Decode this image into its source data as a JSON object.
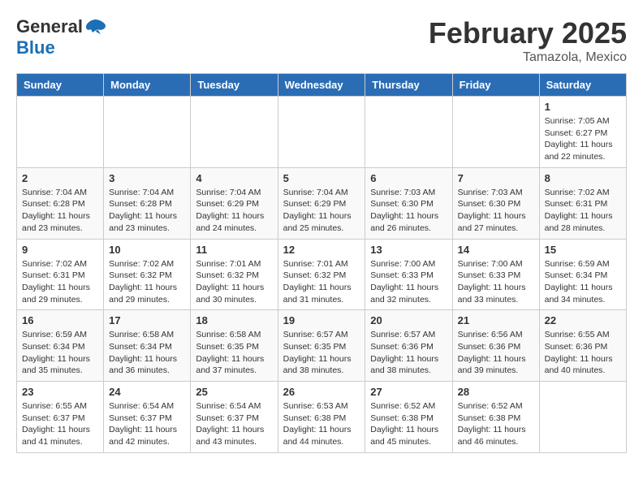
{
  "header": {
    "logo_general": "General",
    "logo_blue": "Blue",
    "month_title": "February 2025",
    "subtitle": "Tamazola, Mexico"
  },
  "days_of_week": [
    "Sunday",
    "Monday",
    "Tuesday",
    "Wednesday",
    "Thursday",
    "Friday",
    "Saturday"
  ],
  "weeks": [
    [
      {
        "day": "",
        "info": ""
      },
      {
        "day": "",
        "info": ""
      },
      {
        "day": "",
        "info": ""
      },
      {
        "day": "",
        "info": ""
      },
      {
        "day": "",
        "info": ""
      },
      {
        "day": "",
        "info": ""
      },
      {
        "day": "1",
        "info": "Sunrise: 7:05 AM\nSunset: 6:27 PM\nDaylight: 11 hours and 22 minutes."
      }
    ],
    [
      {
        "day": "2",
        "info": "Sunrise: 7:04 AM\nSunset: 6:28 PM\nDaylight: 11 hours and 23 minutes."
      },
      {
        "day": "3",
        "info": "Sunrise: 7:04 AM\nSunset: 6:28 PM\nDaylight: 11 hours and 23 minutes."
      },
      {
        "day": "4",
        "info": "Sunrise: 7:04 AM\nSunset: 6:29 PM\nDaylight: 11 hours and 24 minutes."
      },
      {
        "day": "5",
        "info": "Sunrise: 7:04 AM\nSunset: 6:29 PM\nDaylight: 11 hours and 25 minutes."
      },
      {
        "day": "6",
        "info": "Sunrise: 7:03 AM\nSunset: 6:30 PM\nDaylight: 11 hours and 26 minutes."
      },
      {
        "day": "7",
        "info": "Sunrise: 7:03 AM\nSunset: 6:30 PM\nDaylight: 11 hours and 27 minutes."
      },
      {
        "day": "8",
        "info": "Sunrise: 7:02 AM\nSunset: 6:31 PM\nDaylight: 11 hours and 28 minutes."
      }
    ],
    [
      {
        "day": "9",
        "info": "Sunrise: 7:02 AM\nSunset: 6:31 PM\nDaylight: 11 hours and 29 minutes."
      },
      {
        "day": "10",
        "info": "Sunrise: 7:02 AM\nSunset: 6:32 PM\nDaylight: 11 hours and 29 minutes."
      },
      {
        "day": "11",
        "info": "Sunrise: 7:01 AM\nSunset: 6:32 PM\nDaylight: 11 hours and 30 minutes."
      },
      {
        "day": "12",
        "info": "Sunrise: 7:01 AM\nSunset: 6:32 PM\nDaylight: 11 hours and 31 minutes."
      },
      {
        "day": "13",
        "info": "Sunrise: 7:00 AM\nSunset: 6:33 PM\nDaylight: 11 hours and 32 minutes."
      },
      {
        "day": "14",
        "info": "Sunrise: 7:00 AM\nSunset: 6:33 PM\nDaylight: 11 hours and 33 minutes."
      },
      {
        "day": "15",
        "info": "Sunrise: 6:59 AM\nSunset: 6:34 PM\nDaylight: 11 hours and 34 minutes."
      }
    ],
    [
      {
        "day": "16",
        "info": "Sunrise: 6:59 AM\nSunset: 6:34 PM\nDaylight: 11 hours and 35 minutes."
      },
      {
        "day": "17",
        "info": "Sunrise: 6:58 AM\nSunset: 6:34 PM\nDaylight: 11 hours and 36 minutes."
      },
      {
        "day": "18",
        "info": "Sunrise: 6:58 AM\nSunset: 6:35 PM\nDaylight: 11 hours and 37 minutes."
      },
      {
        "day": "19",
        "info": "Sunrise: 6:57 AM\nSunset: 6:35 PM\nDaylight: 11 hours and 38 minutes."
      },
      {
        "day": "20",
        "info": "Sunrise: 6:57 AM\nSunset: 6:36 PM\nDaylight: 11 hours and 38 minutes."
      },
      {
        "day": "21",
        "info": "Sunrise: 6:56 AM\nSunset: 6:36 PM\nDaylight: 11 hours and 39 minutes."
      },
      {
        "day": "22",
        "info": "Sunrise: 6:55 AM\nSunset: 6:36 PM\nDaylight: 11 hours and 40 minutes."
      }
    ],
    [
      {
        "day": "23",
        "info": "Sunrise: 6:55 AM\nSunset: 6:37 PM\nDaylight: 11 hours and 41 minutes."
      },
      {
        "day": "24",
        "info": "Sunrise: 6:54 AM\nSunset: 6:37 PM\nDaylight: 11 hours and 42 minutes."
      },
      {
        "day": "25",
        "info": "Sunrise: 6:54 AM\nSunset: 6:37 PM\nDaylight: 11 hours and 43 minutes."
      },
      {
        "day": "26",
        "info": "Sunrise: 6:53 AM\nSunset: 6:38 PM\nDaylight: 11 hours and 44 minutes."
      },
      {
        "day": "27",
        "info": "Sunrise: 6:52 AM\nSunset: 6:38 PM\nDaylight: 11 hours and 45 minutes."
      },
      {
        "day": "28",
        "info": "Sunrise: 6:52 AM\nSunset: 6:38 PM\nDaylight: 11 hours and 46 minutes."
      },
      {
        "day": "",
        "info": ""
      }
    ]
  ]
}
